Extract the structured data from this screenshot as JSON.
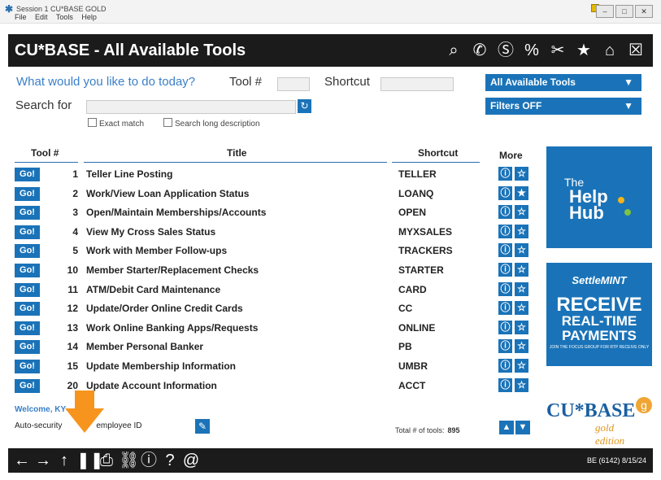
{
  "window": {
    "title": "Session 1 CU*BASE GOLD",
    "menu": [
      "File",
      "Edit",
      "Tools",
      "Help"
    ]
  },
  "header": {
    "title": "CU*BASE - All Available Tools",
    "icons": [
      "search-icon",
      "phone-icon",
      "dollar-icon",
      "percent-icon",
      "tools-icon",
      "star-icon",
      "home-icon",
      "close-icon"
    ]
  },
  "prompt": "What would you like to do today?",
  "tool_num_label": "Tool #",
  "shortcut_label": "Shortcut",
  "search_label": "Search for",
  "exact_match": "Exact match",
  "search_long": "Search long description",
  "tools_dropdown": "All Available Tools",
  "filters_dropdown": "Filters OFF",
  "columns": {
    "tool": "Tool #",
    "title": "Title",
    "shortcut": "Shortcut",
    "more": "More"
  },
  "go_label": "Go!",
  "rows": [
    {
      "num": "1",
      "title": "Teller Line Posting",
      "shortcut": "TELLER",
      "starred": false
    },
    {
      "num": "2",
      "title": "Work/View Loan Application Status",
      "shortcut": "LOANQ",
      "starred": true
    },
    {
      "num": "3",
      "title": "Open/Maintain Memberships/Accounts",
      "shortcut": "OPEN",
      "starred": false
    },
    {
      "num": "4",
      "title": "View My Cross Sales Status",
      "shortcut": "MYXSALES",
      "starred": false
    },
    {
      "num": "5",
      "title": "Work with Member Follow-ups",
      "shortcut": "TRACKERS",
      "starred": false
    },
    {
      "num": "10",
      "title": "Member Starter/Replacement Checks",
      "shortcut": "STARTER",
      "starred": false
    },
    {
      "num": "11",
      "title": "ATM/Debit Card Maintenance",
      "shortcut": "CARD",
      "starred": false
    },
    {
      "num": "12",
      "title": "Update/Order Online Credit Cards",
      "shortcut": "CC",
      "starred": false
    },
    {
      "num": "13",
      "title": "Work Online Banking Apps/Requests",
      "shortcut": "ONLINE",
      "starred": false
    },
    {
      "num": "14",
      "title": "Member Personal Banker",
      "shortcut": "PB",
      "starred": false
    },
    {
      "num": "15",
      "title": "Update Membership Information",
      "shortcut": "UMBR",
      "starred": false
    },
    {
      "num": "20",
      "title": "Update Account Information",
      "shortcut": "ACCT",
      "starred": false
    }
  ],
  "help_hub": {
    "the": "The",
    "line1": "Help",
    "line2": "Hub"
  },
  "settle": {
    "brand": "SettleMINT",
    "line1": "RECEIVE",
    "line2": "REAL-TIME",
    "line3": "PAYMENTS",
    "small": "JOIN THE FOCUS GROUP FOR RTP RECEIVE ONLY"
  },
  "welcome": "Welcome, KY",
  "autosec": "Auto-security",
  "employee_id": "employee ID",
  "total_label": "Total # of tools:",
  "total_value": "895",
  "logo": {
    "main": "CU*BASE",
    "sub": "gold edition",
    "badge": "g"
  },
  "status": "BE (6142) 8/15/24",
  "colors": {
    "accent": "#1a73b8",
    "header_bg": "#1b1b1b",
    "arrow": "#f7941d"
  }
}
